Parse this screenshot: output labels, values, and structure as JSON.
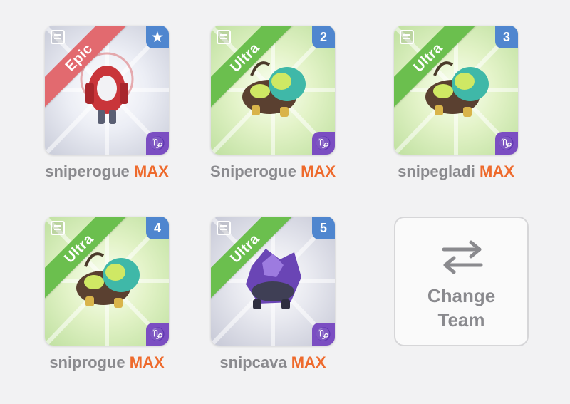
{
  "team": [
    {
      "name": "sniperogue",
      "max_label": "MAX",
      "rarity": "Epic",
      "badge": "★",
      "badge_icon": "star-icon",
      "zodiac": "♑",
      "zodiac_icon": "capricorn-icon",
      "theme": "epic",
      "creature_color": "#c9353a"
    },
    {
      "name": "Sniperogue",
      "max_label": "MAX",
      "rarity": "Ultra",
      "badge": "2",
      "zodiac": "♑",
      "zodiac_icon": "capricorn-icon",
      "theme": "ultra-green",
      "creature_color": "#3fb8a8"
    },
    {
      "name": "snipegladi",
      "max_label": "MAX",
      "rarity": "Ultra",
      "badge": "3",
      "zodiac": "♑",
      "zodiac_icon": "capricorn-icon",
      "theme": "ultra-green",
      "creature_color": "#3fb8a8"
    },
    {
      "name": "sniprogue",
      "max_label": "MAX",
      "rarity": "Ultra",
      "badge": "4",
      "zodiac": "♑",
      "zodiac_icon": "capricorn-icon",
      "theme": "ultra-green",
      "creature_color": "#3fb8a8"
    },
    {
      "name": "snipcava",
      "max_label": "MAX",
      "rarity": "Ultra",
      "badge": "5",
      "zodiac": "♑",
      "zodiac_icon": "capricorn-icon",
      "theme": "ultra-gray",
      "creature_color": "#6a45b5"
    }
  ],
  "change_team": {
    "line1": "Change",
    "line2": "Team",
    "icon": "swap-arrows-icon"
  },
  "colors": {
    "epic_ribbon": "#e26a6f",
    "ultra_ribbon": "#6bbf4e",
    "max": "#ee6a2c",
    "badge": "#4f86cf",
    "zodiac": "#7b4ec2"
  }
}
